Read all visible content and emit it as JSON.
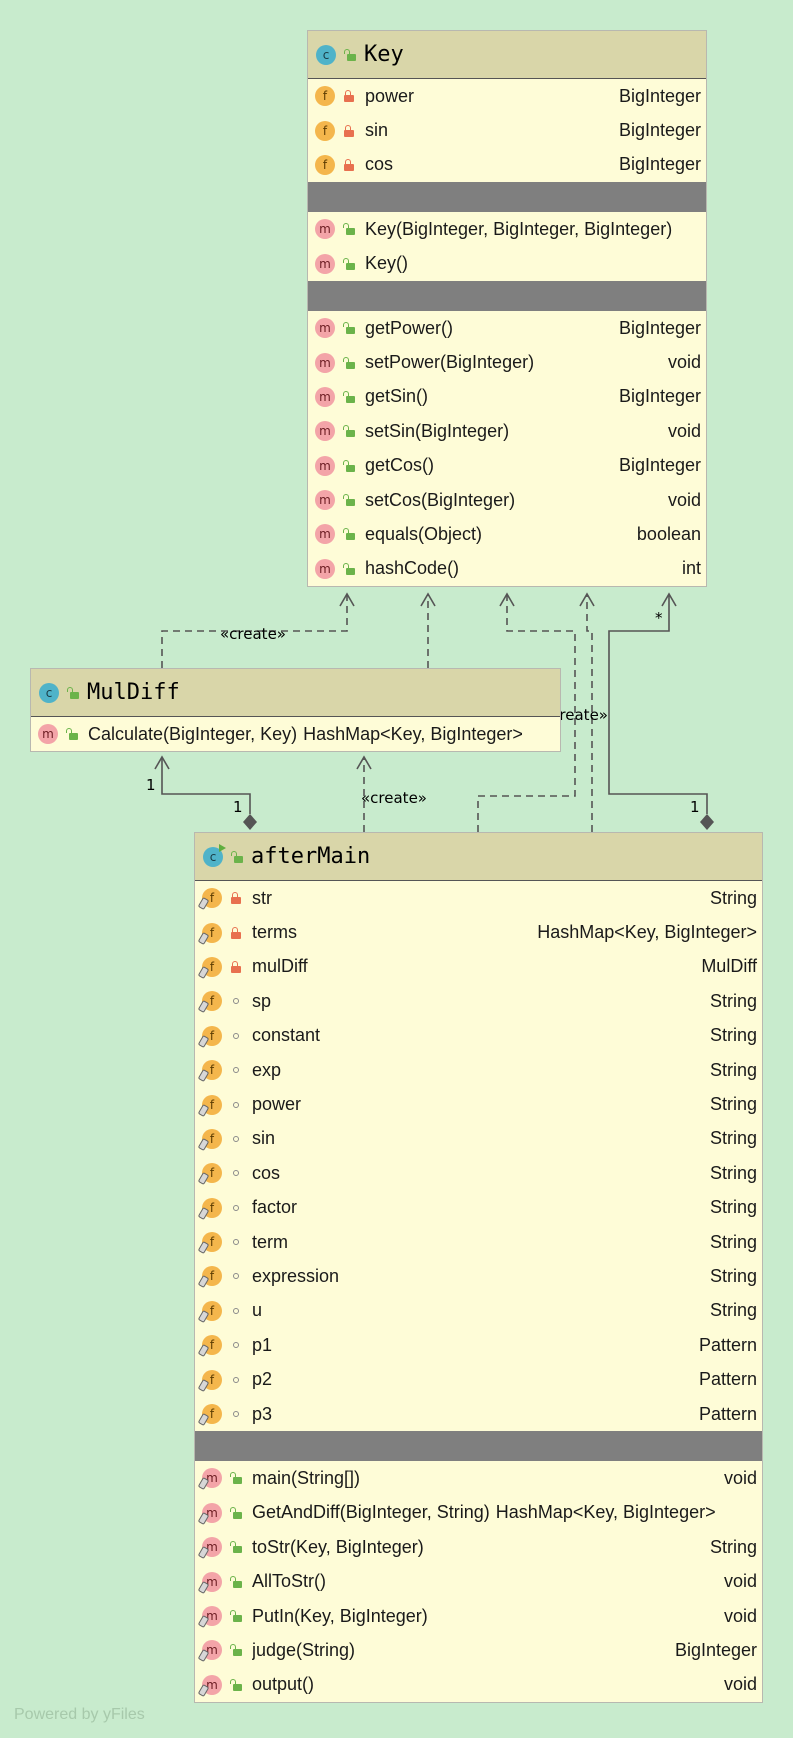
{
  "edge_labels": {
    "create": "«create»",
    "many": "*",
    "one": "1"
  },
  "classes": {
    "key": {
      "name": "Key",
      "fields": [
        {
          "name": "power",
          "type": "BigInteger"
        },
        {
          "name": "sin",
          "type": "BigInteger"
        },
        {
          "name": "cos",
          "type": "BigInteger"
        }
      ],
      "constructors": [
        {
          "name": "Key(BigInteger, BigInteger, BigInteger)"
        },
        {
          "name": "Key()"
        }
      ],
      "methods": [
        {
          "name": "getPower()",
          "type": "BigInteger"
        },
        {
          "name": "setPower(BigInteger)",
          "type": "void"
        },
        {
          "name": "getSin()",
          "type": "BigInteger"
        },
        {
          "name": "setSin(BigInteger)",
          "type": "void"
        },
        {
          "name": "getCos()",
          "type": "BigInteger"
        },
        {
          "name": "setCos(BigInteger)",
          "type": "void"
        },
        {
          "name": "equals(Object)",
          "type": "boolean"
        },
        {
          "name": "hashCode()",
          "type": "int"
        }
      ]
    },
    "muldiff": {
      "name": "MulDiff",
      "methods": [
        {
          "name": "Calculate(BigInteger, Key)",
          "type": "HashMap<Key, BigInteger>"
        }
      ]
    },
    "aftermain": {
      "name": "afterMain",
      "fields": [
        {
          "name": "str",
          "type": "String",
          "vis": "private"
        },
        {
          "name": "terms",
          "type": "HashMap<Key, BigInteger>",
          "vis": "private"
        },
        {
          "name": "mulDiff",
          "type": "MulDiff",
          "vis": "private"
        },
        {
          "name": "sp",
          "type": "String",
          "vis": "package"
        },
        {
          "name": "constant",
          "type": "String",
          "vis": "package"
        },
        {
          "name": "exp",
          "type": "String",
          "vis": "package"
        },
        {
          "name": "power",
          "type": "String",
          "vis": "package"
        },
        {
          "name": "sin",
          "type": "String",
          "vis": "package"
        },
        {
          "name": "cos",
          "type": "String",
          "vis": "package"
        },
        {
          "name": "factor",
          "type": "String",
          "vis": "package"
        },
        {
          "name": "term",
          "type": "String",
          "vis": "package"
        },
        {
          "name": "expression",
          "type": "String",
          "vis": "package"
        },
        {
          "name": "u",
          "type": "String",
          "vis": "package"
        },
        {
          "name": "p1",
          "type": "Pattern",
          "vis": "package"
        },
        {
          "name": "p2",
          "type": "Pattern",
          "vis": "package"
        },
        {
          "name": "p3",
          "type": "Pattern",
          "vis": "package"
        }
      ],
      "methods": [
        {
          "name": "main(String[])",
          "type": "void"
        },
        {
          "name": "GetAndDiff(BigInteger, String)",
          "type": "HashMap<Key, BigInteger>"
        },
        {
          "name": "toStr(Key, BigInteger)",
          "type": "String"
        },
        {
          "name": "AllToStr()",
          "type": "void"
        },
        {
          "name": "PutIn(Key, BigInteger)",
          "type": "void"
        },
        {
          "name": "judge(String)",
          "type": "BigInteger"
        },
        {
          "name": "output()",
          "type": "void"
        }
      ]
    }
  },
  "footer": {
    "watermark": "Powered by yFiles"
  },
  "icons": {
    "class": "class-icon",
    "field": "field-icon",
    "method": "method-icon",
    "private": "lock-icon",
    "public": "unlock-icon",
    "package": "circle-icon"
  }
}
